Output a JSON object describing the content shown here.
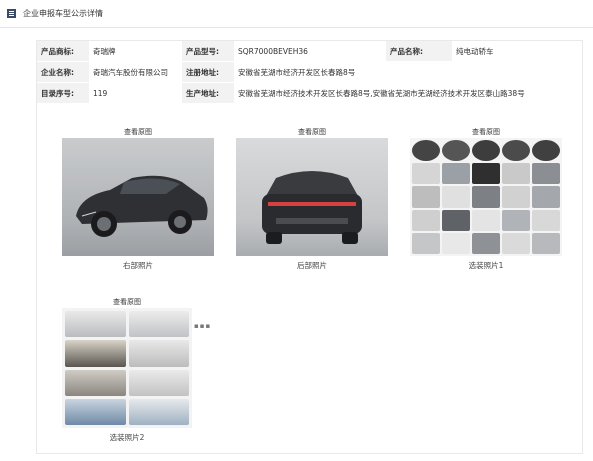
{
  "page": {
    "title": "企业申报车型公示详情"
  },
  "info": {
    "row1": [
      {
        "label": "产品商标:",
        "value": "奇瑞牌"
      },
      {
        "label": "产品型号:",
        "value": "SQR7000BEVEH36"
      },
      {
        "label": "产品名称:",
        "value": "纯电动轿车"
      }
    ],
    "row2": [
      {
        "label": "企业名称:",
        "value": "奇瑞汽车股份有限公司"
      },
      {
        "label": "注册地址:",
        "value": "安徽省芜湖市经济开发区长春路8号"
      }
    ],
    "row3": [
      {
        "label": "目录序号:",
        "value": "119"
      },
      {
        "label": "生产地址:",
        "value": "安徽省芜湖市经济技术开发区长春路8号,安徽省芜湖市芜湖经济技术开发区泰山路38号"
      }
    ]
  },
  "photos": [
    {
      "view": "查看原图",
      "caption": "右部照片"
    },
    {
      "view": "查看原图",
      "caption": "后部照片"
    },
    {
      "view": "查看原图",
      "caption": "选装照片1"
    },
    {
      "view": "查看原图",
      "caption": "选装照片2"
    }
  ],
  "more": "▪▪▪"
}
